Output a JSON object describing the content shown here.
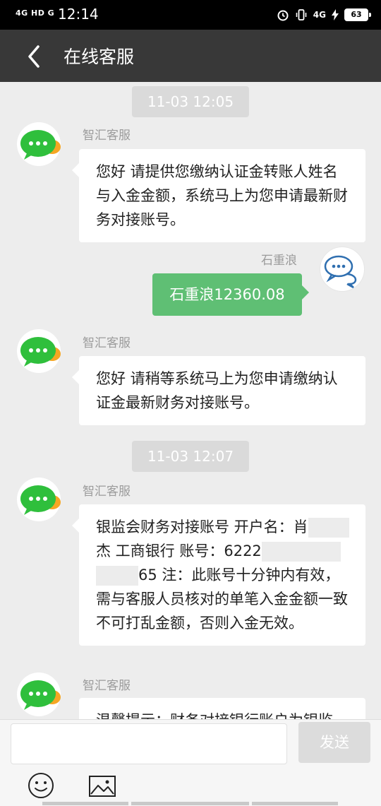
{
  "status_bar": {
    "network_left": "4G HD G",
    "time": "12:14",
    "network_right": "4G",
    "battery": "63"
  },
  "header": {
    "title": "在线客服"
  },
  "messages": {
    "ts1": "11-03 12:05",
    "m1_sender": "智汇客服",
    "m1_text": "您好 请提供您缴纳认证金转账人姓名与入金金额，系统马上为您申请最新财务对接账号。",
    "m2_sender": "石重浪",
    "m2_text": "石重浪12360.08",
    "m3_sender": "智汇客服",
    "m3_text": "您好 请稍等系统马上为您申请缴纳认证金最新财务对接账号。",
    "ts2": "11-03 12:07",
    "m4_sender": "智汇客服",
    "m4_part1": "银监会财务对接账号 开户名：肖",
    "m4_part2": "杰 工商银行 账号：6222",
    "m4_part3": "65 注：此账号十分钟内有效，需与客服人员核对的单笔入金金额一致不可打乱金额，否则入金无效。",
    "m5_sender": "智汇客服",
    "m5_text": "温馨提示：财务对接银行账户为银监"
  },
  "input": {
    "placeholder": "",
    "send_label": "发送"
  },
  "colors": {
    "header_bg": "#383838",
    "chat_bg": "#ededed",
    "bubble_self": "#5fbf74",
    "avatar_green": "#2fbf3c"
  }
}
